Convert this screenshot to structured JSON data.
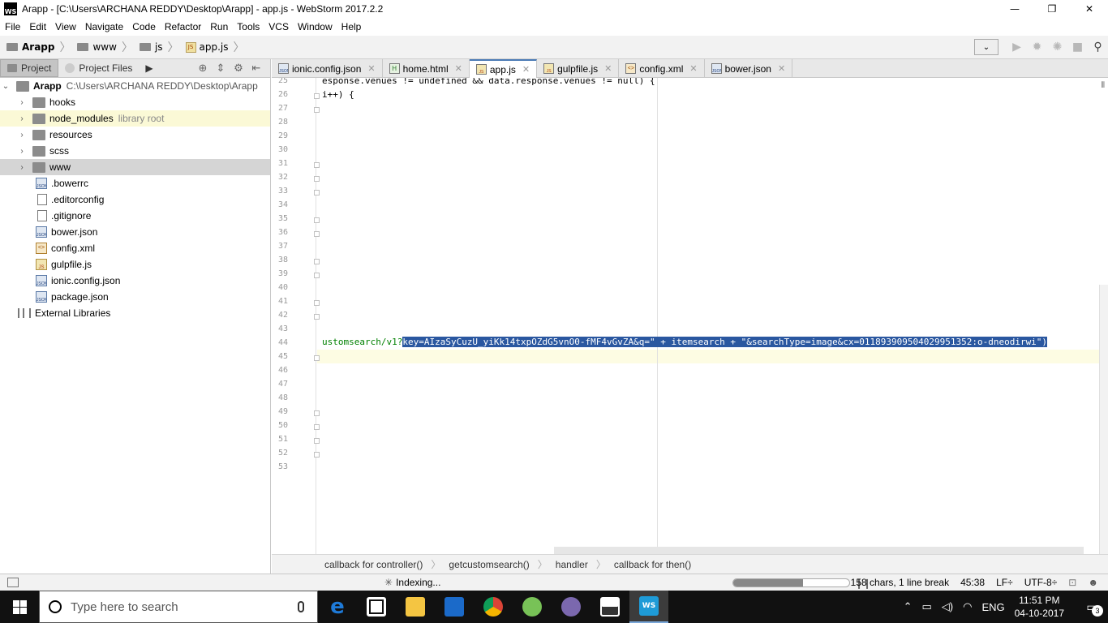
{
  "window": {
    "title": "Arapp - [C:\\Users\\ARCHANA REDDY\\Desktop\\Arapp] - app.js - WebStorm 2017.2.2",
    "logo": "WS",
    "minimize": "—",
    "maximize": "❐",
    "close": "✕"
  },
  "menu": [
    "File",
    "Edit",
    "View",
    "Navigate",
    "Code",
    "Refactor",
    "Run",
    "Tools",
    "VCS",
    "Window",
    "Help"
  ],
  "nav": {
    "project": "Arapp",
    "folder1": "www",
    "folder2": "js",
    "file": "app.js",
    "sep": "〉"
  },
  "panel": {
    "tab_project": "Project",
    "tab_project_files": "Project Files",
    "tab_more": "▶"
  },
  "tree": {
    "root_name": "Arapp",
    "root_path": "C:\\Users\\ARCHANA REDDY\\Desktop\\Arapp",
    "folders": [
      "hooks",
      "node_modules",
      "resources",
      "scss",
      "www"
    ],
    "library_root": "library root",
    "files": [
      ".bowerrc",
      ".editorconfig",
      ".gitignore",
      "bower.json",
      "config.xml",
      "gulpfile.js",
      "ionic.config.json",
      "package.json"
    ],
    "external": "External Libraries"
  },
  "editor_tabs": [
    "ionic.config.json",
    "home.html",
    "app.js",
    "gulpfile.js",
    "config.xml",
    "bower.json"
  ],
  "tab_close": "✕",
  "code": {
    "line_numbers": [
      "25",
      "26",
      "27",
      "28",
      "29",
      "30",
      "31",
      "32",
      "33",
      "34",
      "35",
      "36",
      "37",
      "38",
      "39",
      "40",
      "41",
      "42",
      "43",
      "44",
      "45",
      "46",
      "47",
      "48",
      "49",
      "50",
      "51",
      "52",
      "53"
    ],
    "line25": "esponse.venues != undefined && data.response.venues != null) {",
    "line26": "i++) {",
    "line44_prefix": "ustomsearch/v1?",
    "line44_selected": "key=AIzaSyCuzU_yiKk14txpOZdG5vnO0-fMF4vGvZA&q=",
    "line44_rest": "\" + itemsearch + \"&searchType=image&cx=011893909504029951352:o-dneodirwi\")"
  },
  "breadcrumbs": [
    "callback for controller()",
    "getcustomsearch()",
    "handler",
    "callback for then()"
  ],
  "status": {
    "indexing": "Indexing...",
    "indexing_progress": 0.6,
    "chars": "158 chars, 1 line break",
    "position": "45:38",
    "line_sep": "LF÷",
    "encoding": "UTF-8÷"
  },
  "taskbar": {
    "search_placeholder": "Type here to search",
    "lang": "ENG",
    "time": "11:51 PM",
    "date": "04-10-2017",
    "notifications": "3"
  }
}
